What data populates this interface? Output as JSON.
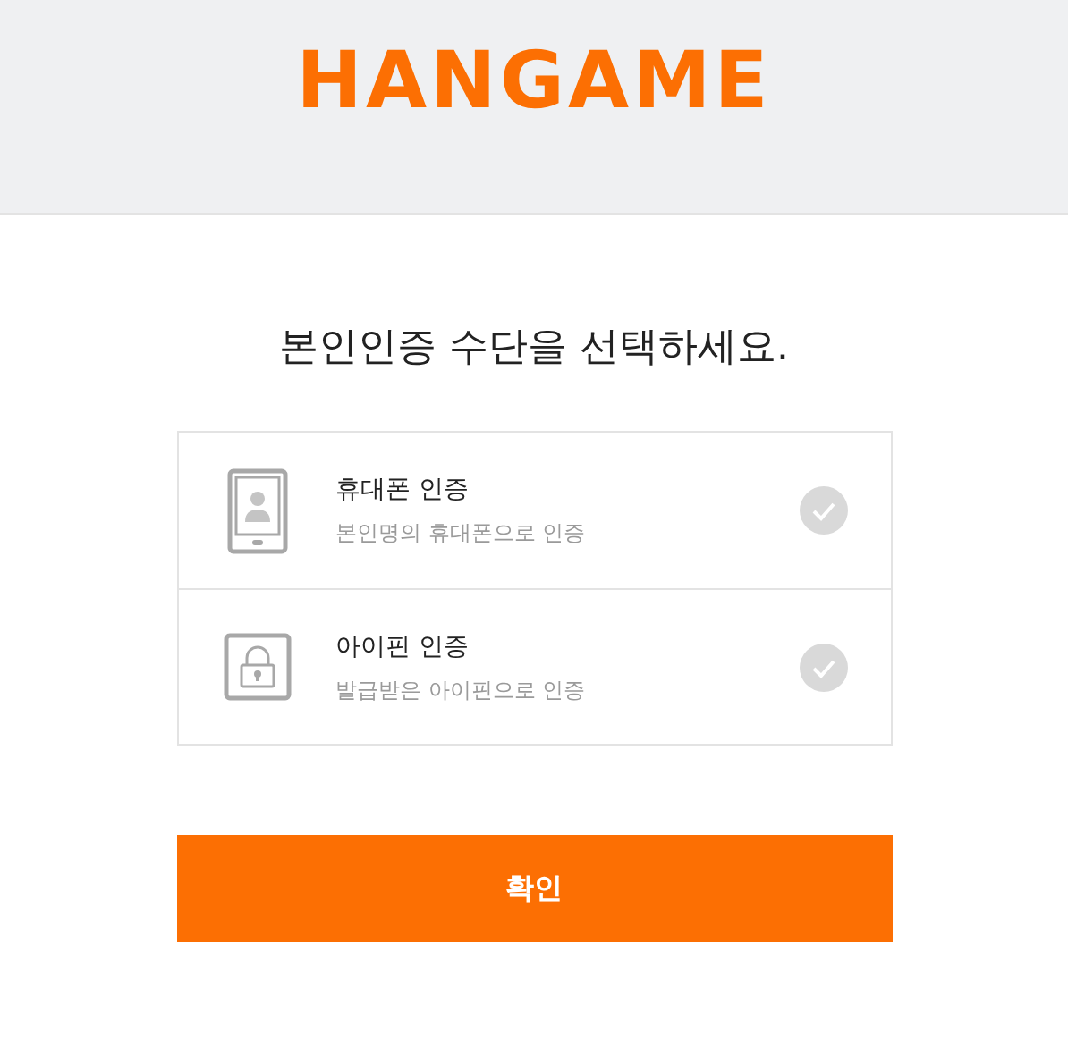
{
  "header": {
    "logo": "HANGAME"
  },
  "heading": "본인인증 수단을 선택하세요.",
  "options": [
    {
      "kind": "phone",
      "title": "휴대폰 인증",
      "description": "본인명의 휴대폰으로 인증",
      "selected": false
    },
    {
      "kind": "ipin",
      "title": "아이핀 인증",
      "description": "발급받은 아이핀으로 인증",
      "selected": false
    }
  ],
  "confirm_button": "확인"
}
